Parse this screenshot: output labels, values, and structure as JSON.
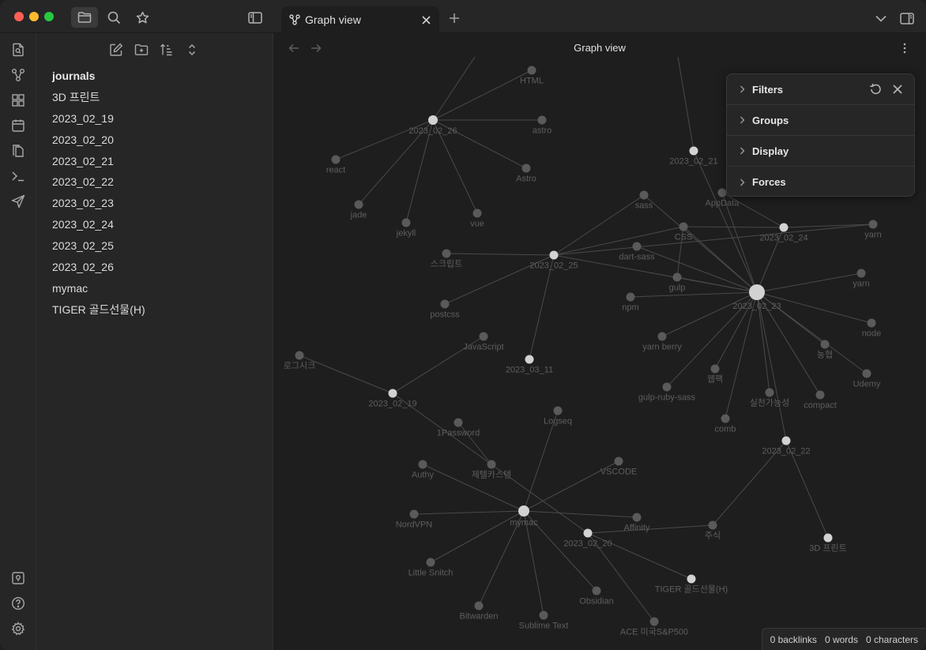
{
  "tabs": [
    {
      "label": "Graph view",
      "active": true
    }
  ],
  "view": {
    "title": "Graph view"
  },
  "explorer": {
    "files": [
      {
        "label": "journals",
        "type": "folder"
      },
      {
        "label": "3D 프린트",
        "type": "file"
      },
      {
        "label": "2023_02_19",
        "type": "file"
      },
      {
        "label": "2023_02_20",
        "type": "file"
      },
      {
        "label": "2023_02_21",
        "type": "file"
      },
      {
        "label": "2023_02_22",
        "type": "file"
      },
      {
        "label": "2023_02_23",
        "type": "file"
      },
      {
        "label": "2023_02_24",
        "type": "file"
      },
      {
        "label": "2023_02_25",
        "type": "file"
      },
      {
        "label": "2023_02_26",
        "type": "file"
      },
      {
        "label": "mymac",
        "type": "file"
      },
      {
        "label": "TIGER 골드선물(H)",
        "type": "file"
      }
    ]
  },
  "graph_controls": {
    "sections": [
      "Filters",
      "Groups",
      "Display",
      "Forces"
    ]
  },
  "graph": {
    "nodes": [
      {
        "id": "n26",
        "label": "2023_02_26",
        "kind": "page"
      },
      {
        "id": "html",
        "label": "HTML",
        "kind": "tag"
      },
      {
        "id": "astro",
        "label": "astro",
        "kind": "tag"
      },
      {
        "id": "react",
        "label": "react",
        "kind": "tag"
      },
      {
        "id": "Astro",
        "label": "Astro",
        "kind": "tag"
      },
      {
        "id": "jade",
        "label": "jade",
        "kind": "tag"
      },
      {
        "id": "jekyll",
        "label": "jekyll",
        "kind": "tag"
      },
      {
        "id": "vue",
        "label": "vue",
        "kind": "tag"
      },
      {
        "id": "n21",
        "label": "2023_02_21",
        "kind": "page"
      },
      {
        "id": "appdata",
        "label": "AppData",
        "kind": "tag"
      },
      {
        "id": "n24",
        "label": "2023_02_24",
        "kind": "page"
      },
      {
        "id": "sass",
        "label": "sass",
        "kind": "tag"
      },
      {
        "id": "css",
        "label": "CSS",
        "kind": "tag"
      },
      {
        "id": "yarn1",
        "label": "yarn",
        "kind": "tag"
      },
      {
        "id": "n25",
        "label": "2023_02_25",
        "kind": "page"
      },
      {
        "id": "script",
        "label": "스크립트",
        "kind": "tag"
      },
      {
        "id": "dartsass",
        "label": "dart-sass",
        "kind": "tag"
      },
      {
        "id": "gulp",
        "label": "gulp",
        "kind": "tag"
      },
      {
        "id": "n23",
        "label": "2023_02_23",
        "kind": "page"
      },
      {
        "id": "yarn2",
        "label": "yarn",
        "kind": "tag"
      },
      {
        "id": "npm",
        "label": "npm",
        "kind": "tag"
      },
      {
        "id": "postcss",
        "label": "postcss",
        "kind": "tag"
      },
      {
        "id": "node",
        "label": "node",
        "kind": "tag"
      },
      {
        "id": "yarnberry",
        "label": "yarn berry",
        "kind": "tag"
      },
      {
        "id": "nonghyup",
        "label": "농협",
        "kind": "tag"
      },
      {
        "id": "js",
        "label": "JavaScript",
        "kind": "tag"
      },
      {
        "id": "n311",
        "label": "2023_03_11",
        "kind": "page"
      },
      {
        "id": "webpack",
        "label": "웹팩",
        "kind": "tag"
      },
      {
        "id": "udemy",
        "label": "Udemy",
        "kind": "tag"
      },
      {
        "id": "logseek",
        "label": "로그시크",
        "kind": "tag"
      },
      {
        "id": "gulprubysass",
        "label": "gulp-ruby-sass",
        "kind": "tag"
      },
      {
        "id": "silcheon",
        "label": "실천가능성",
        "kind": "tag"
      },
      {
        "id": "compact",
        "label": "compact",
        "kind": "tag"
      },
      {
        "id": "n19",
        "label": "2023_02_19",
        "kind": "page"
      },
      {
        "id": "logseq",
        "label": "Logseq",
        "kind": "tag"
      },
      {
        "id": "comb",
        "label": "comb",
        "kind": "tag"
      },
      {
        "id": "onepw",
        "label": "1Password",
        "kind": "tag"
      },
      {
        "id": "n22",
        "label": "2023_02_22",
        "kind": "page"
      },
      {
        "id": "authy",
        "label": "Authy",
        "kind": "tag"
      },
      {
        "id": "telegram",
        "label": "제텔카스텐",
        "kind": "tag"
      },
      {
        "id": "vscode",
        "label": "VSCODE",
        "kind": "tag"
      },
      {
        "id": "nordvpn",
        "label": "NordVPN",
        "kind": "tag"
      },
      {
        "id": "mymac",
        "label": "mymac",
        "kind": "page"
      },
      {
        "id": "affinity",
        "label": "Affinity",
        "kind": "tag"
      },
      {
        "id": "stock",
        "label": "주식",
        "kind": "tag"
      },
      {
        "id": "n20",
        "label": "2023_02_20",
        "kind": "page"
      },
      {
        "id": "print3d",
        "label": "3D 프린트",
        "kind": "page"
      },
      {
        "id": "littlesnitch",
        "label": "Little Snitch",
        "kind": "tag"
      },
      {
        "id": "tiger",
        "label": "TIGER 골드선물(H)",
        "kind": "page"
      },
      {
        "id": "obsidian",
        "label": "Obsidian",
        "kind": "tag"
      },
      {
        "id": "bitwarden",
        "label": "Bitwarden",
        "kind": "tag"
      },
      {
        "id": "sublime",
        "label": "Sublime Text",
        "kind": "tag"
      },
      {
        "id": "ace",
        "label": "ACE 미국S&P500",
        "kind": "tag"
      }
    ],
    "edges": [
      [
        "n26",
        "html"
      ],
      [
        "n26",
        "astro"
      ],
      [
        "n26",
        "react"
      ],
      [
        "n26",
        "Astro"
      ],
      [
        "n26",
        "jade"
      ],
      [
        "n26",
        "jekyll"
      ],
      [
        "n26",
        "vue"
      ],
      [
        "n25",
        "sass"
      ],
      [
        "n25",
        "css"
      ],
      [
        "n25",
        "yarn1"
      ],
      [
        "n25",
        "script"
      ],
      [
        "n25",
        "postcss"
      ],
      [
        "n25",
        "n311"
      ],
      [
        "n25",
        "n23"
      ],
      [
        "n24",
        "css"
      ],
      [
        "n24",
        "yarn1"
      ],
      [
        "n24",
        "n23"
      ],
      [
        "n24",
        "appdata"
      ],
      [
        "n21",
        "n23"
      ],
      [
        "n23",
        "css"
      ],
      [
        "n23",
        "sass"
      ],
      [
        "n23",
        "gulp"
      ],
      [
        "n23",
        "dartsass"
      ],
      [
        "n23",
        "appdata"
      ],
      [
        "n23",
        "yarn2"
      ],
      [
        "n23",
        "npm"
      ],
      [
        "n23",
        "node"
      ],
      [
        "n23",
        "yarnberry"
      ],
      [
        "n23",
        "nonghyup"
      ],
      [
        "n23",
        "webpack"
      ],
      [
        "n23",
        "udemy"
      ],
      [
        "n23",
        "gulprubysass"
      ],
      [
        "n23",
        "silcheon"
      ],
      [
        "n23",
        "compact"
      ],
      [
        "n23",
        "comb"
      ],
      [
        "n23",
        "n22"
      ],
      [
        "gulp",
        "css"
      ],
      [
        "n19",
        "js"
      ],
      [
        "n19",
        "logseek"
      ],
      [
        "n19",
        "telegram"
      ],
      [
        "telegram",
        "onepw"
      ],
      [
        "telegram",
        "n20"
      ],
      [
        "mymac",
        "logseq"
      ],
      [
        "mymac",
        "authy"
      ],
      [
        "mymac",
        "vscode"
      ],
      [
        "mymac",
        "nordvpn"
      ],
      [
        "mymac",
        "affinity"
      ],
      [
        "mymac",
        "littlesnitch"
      ],
      [
        "mymac",
        "bitwarden"
      ],
      [
        "mymac",
        "sublime"
      ],
      [
        "mymac",
        "obsidian"
      ],
      [
        "n20",
        "stock"
      ],
      [
        "n20",
        "tiger"
      ],
      [
        "n20",
        "ace"
      ],
      [
        "stock",
        "n22"
      ],
      [
        "n22",
        "print3d"
      ]
    ]
  },
  "status": {
    "backlinks": "0 backlinks",
    "words": "0 words",
    "characters": "0 characters"
  }
}
